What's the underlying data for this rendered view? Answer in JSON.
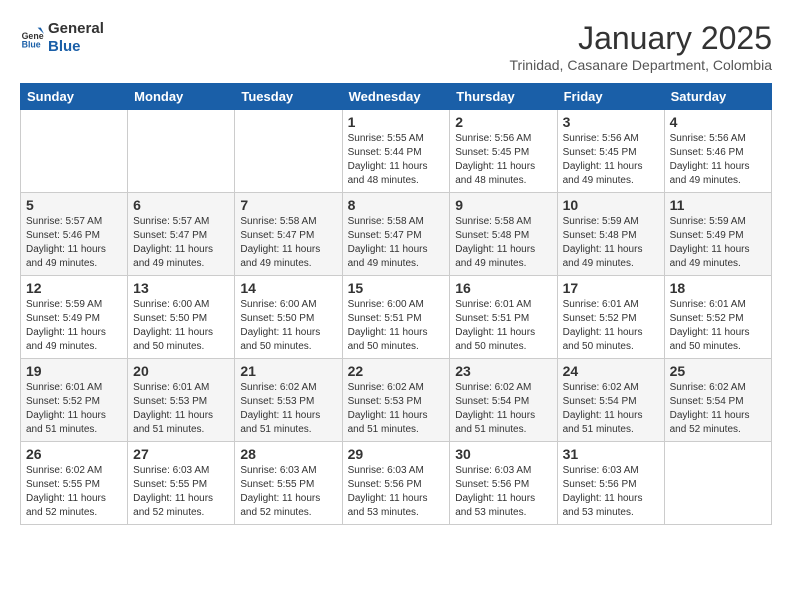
{
  "logo": {
    "line1": "General",
    "line2": "Blue"
  },
  "header": {
    "month": "January 2025",
    "location": "Trinidad, Casanare Department, Colombia"
  },
  "weekdays": [
    "Sunday",
    "Monday",
    "Tuesday",
    "Wednesday",
    "Thursday",
    "Friday",
    "Saturday"
  ],
  "weeks": [
    [
      {
        "day": "",
        "sunrise": "",
        "sunset": "",
        "daylight": ""
      },
      {
        "day": "",
        "sunrise": "",
        "sunset": "",
        "daylight": ""
      },
      {
        "day": "",
        "sunrise": "",
        "sunset": "",
        "daylight": ""
      },
      {
        "day": "1",
        "sunrise": "Sunrise: 5:55 AM",
        "sunset": "Sunset: 5:44 PM",
        "daylight": "Daylight: 11 hours and 48 minutes."
      },
      {
        "day": "2",
        "sunrise": "Sunrise: 5:56 AM",
        "sunset": "Sunset: 5:45 PM",
        "daylight": "Daylight: 11 hours and 48 minutes."
      },
      {
        "day": "3",
        "sunrise": "Sunrise: 5:56 AM",
        "sunset": "Sunset: 5:45 PM",
        "daylight": "Daylight: 11 hours and 49 minutes."
      },
      {
        "day": "4",
        "sunrise": "Sunrise: 5:56 AM",
        "sunset": "Sunset: 5:46 PM",
        "daylight": "Daylight: 11 hours and 49 minutes."
      }
    ],
    [
      {
        "day": "5",
        "sunrise": "Sunrise: 5:57 AM",
        "sunset": "Sunset: 5:46 PM",
        "daylight": "Daylight: 11 hours and 49 minutes."
      },
      {
        "day": "6",
        "sunrise": "Sunrise: 5:57 AM",
        "sunset": "Sunset: 5:47 PM",
        "daylight": "Daylight: 11 hours and 49 minutes."
      },
      {
        "day": "7",
        "sunrise": "Sunrise: 5:58 AM",
        "sunset": "Sunset: 5:47 PM",
        "daylight": "Daylight: 11 hours and 49 minutes."
      },
      {
        "day": "8",
        "sunrise": "Sunrise: 5:58 AM",
        "sunset": "Sunset: 5:47 PM",
        "daylight": "Daylight: 11 hours and 49 minutes."
      },
      {
        "day": "9",
        "sunrise": "Sunrise: 5:58 AM",
        "sunset": "Sunset: 5:48 PM",
        "daylight": "Daylight: 11 hours and 49 minutes."
      },
      {
        "day": "10",
        "sunrise": "Sunrise: 5:59 AM",
        "sunset": "Sunset: 5:48 PM",
        "daylight": "Daylight: 11 hours and 49 minutes."
      },
      {
        "day": "11",
        "sunrise": "Sunrise: 5:59 AM",
        "sunset": "Sunset: 5:49 PM",
        "daylight": "Daylight: 11 hours and 49 minutes."
      }
    ],
    [
      {
        "day": "12",
        "sunrise": "Sunrise: 5:59 AM",
        "sunset": "Sunset: 5:49 PM",
        "daylight": "Daylight: 11 hours and 49 minutes."
      },
      {
        "day": "13",
        "sunrise": "Sunrise: 6:00 AM",
        "sunset": "Sunset: 5:50 PM",
        "daylight": "Daylight: 11 hours and 50 minutes."
      },
      {
        "day": "14",
        "sunrise": "Sunrise: 6:00 AM",
        "sunset": "Sunset: 5:50 PM",
        "daylight": "Daylight: 11 hours and 50 minutes."
      },
      {
        "day": "15",
        "sunrise": "Sunrise: 6:00 AM",
        "sunset": "Sunset: 5:51 PM",
        "daylight": "Daylight: 11 hours and 50 minutes."
      },
      {
        "day": "16",
        "sunrise": "Sunrise: 6:01 AM",
        "sunset": "Sunset: 5:51 PM",
        "daylight": "Daylight: 11 hours and 50 minutes."
      },
      {
        "day": "17",
        "sunrise": "Sunrise: 6:01 AM",
        "sunset": "Sunset: 5:52 PM",
        "daylight": "Daylight: 11 hours and 50 minutes."
      },
      {
        "day": "18",
        "sunrise": "Sunrise: 6:01 AM",
        "sunset": "Sunset: 5:52 PM",
        "daylight": "Daylight: 11 hours and 50 minutes."
      }
    ],
    [
      {
        "day": "19",
        "sunrise": "Sunrise: 6:01 AM",
        "sunset": "Sunset: 5:52 PM",
        "daylight": "Daylight: 11 hours and 51 minutes."
      },
      {
        "day": "20",
        "sunrise": "Sunrise: 6:01 AM",
        "sunset": "Sunset: 5:53 PM",
        "daylight": "Daylight: 11 hours and 51 minutes."
      },
      {
        "day": "21",
        "sunrise": "Sunrise: 6:02 AM",
        "sunset": "Sunset: 5:53 PM",
        "daylight": "Daylight: 11 hours and 51 minutes."
      },
      {
        "day": "22",
        "sunrise": "Sunrise: 6:02 AM",
        "sunset": "Sunset: 5:53 PM",
        "daylight": "Daylight: 11 hours and 51 minutes."
      },
      {
        "day": "23",
        "sunrise": "Sunrise: 6:02 AM",
        "sunset": "Sunset: 5:54 PM",
        "daylight": "Daylight: 11 hours and 51 minutes."
      },
      {
        "day": "24",
        "sunrise": "Sunrise: 6:02 AM",
        "sunset": "Sunset: 5:54 PM",
        "daylight": "Daylight: 11 hours and 51 minutes."
      },
      {
        "day": "25",
        "sunrise": "Sunrise: 6:02 AM",
        "sunset": "Sunset: 5:54 PM",
        "daylight": "Daylight: 11 hours and 52 minutes."
      }
    ],
    [
      {
        "day": "26",
        "sunrise": "Sunrise: 6:02 AM",
        "sunset": "Sunset: 5:55 PM",
        "daylight": "Daylight: 11 hours and 52 minutes."
      },
      {
        "day": "27",
        "sunrise": "Sunrise: 6:03 AM",
        "sunset": "Sunset: 5:55 PM",
        "daylight": "Daylight: 11 hours and 52 minutes."
      },
      {
        "day": "28",
        "sunrise": "Sunrise: 6:03 AM",
        "sunset": "Sunset: 5:55 PM",
        "daylight": "Daylight: 11 hours and 52 minutes."
      },
      {
        "day": "29",
        "sunrise": "Sunrise: 6:03 AM",
        "sunset": "Sunset: 5:56 PM",
        "daylight": "Daylight: 11 hours and 53 minutes."
      },
      {
        "day": "30",
        "sunrise": "Sunrise: 6:03 AM",
        "sunset": "Sunset: 5:56 PM",
        "daylight": "Daylight: 11 hours and 53 minutes."
      },
      {
        "day": "31",
        "sunrise": "Sunrise: 6:03 AM",
        "sunset": "Sunset: 5:56 PM",
        "daylight": "Daylight: 11 hours and 53 minutes."
      },
      {
        "day": "",
        "sunrise": "",
        "sunset": "",
        "daylight": ""
      }
    ]
  ]
}
